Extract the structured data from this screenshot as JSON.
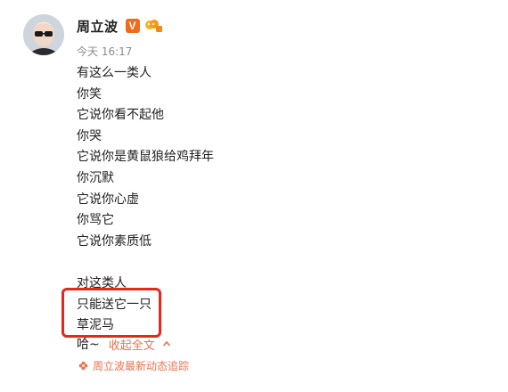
{
  "user": {
    "name": "周立波",
    "verified_badge": "V"
  },
  "post": {
    "timestamp": "今天 16:17",
    "lines": [
      "有这么一类人",
      "你笑",
      "它说你看不起他",
      "你哭",
      "它说你是黄鼠狼给鸡拜年",
      "你沉默",
      "它说你心虚",
      "你骂它",
      "它说你素质低",
      "",
      "对这类人",
      "只能送它一只",
      "草泥马"
    ],
    "tail_text": "哈~",
    "collapse_label": "收起全文",
    "follow_label": "周立波最新动态追踪"
  },
  "colors": {
    "link": "#eb7350",
    "highlight": "#e8261c",
    "verified": "#f26b1d"
  },
  "icons": [
    "avatar",
    "verified-icon",
    "level-icon",
    "chevron-up-icon",
    "flower-icon"
  ]
}
